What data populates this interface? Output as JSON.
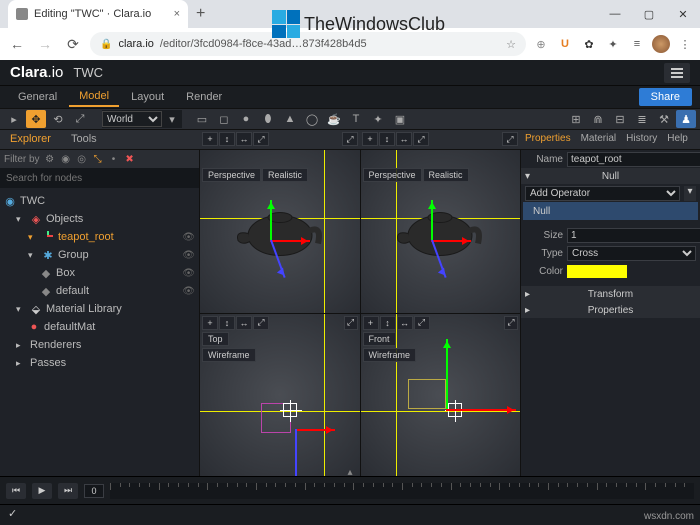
{
  "browser": {
    "tab_title": "Editing \"TWC\" · Clara.io",
    "url_host": "clara.io",
    "url_path": "/editor/3fcd0984-f8ce-43ad…873f428b4d5",
    "ext_u": "U",
    "win_min": "—",
    "win_max": "▢",
    "win_close": "✕",
    "star": "☆",
    "key": "⊕"
  },
  "watermark": {
    "text": "TheWindowsClub",
    "sub": "wsxdn.com"
  },
  "header": {
    "logo1": "Clara",
    "logo2": ".io",
    "project": "TWC"
  },
  "tabs": {
    "general": "General",
    "model": "Model",
    "layout": "Layout",
    "render": "Render",
    "share": "Share"
  },
  "toolbar": {
    "coordsys": "World"
  },
  "panelhead": {
    "explorer": "Explorer",
    "tools": "Tools",
    "properties": "Properties",
    "material": "Material",
    "history": "History",
    "help": "Help"
  },
  "filter": {
    "label": "Filter by",
    "search_ph": "Search for nodes"
  },
  "tree": {
    "root": "TWC",
    "objects": "Objects",
    "teapot": "teapot_root",
    "group": "Group",
    "box": "Box",
    "default": "default",
    "matlib": "Material Library",
    "defaultmat": "defaultMat",
    "renderers": "Renderers",
    "passes": "Passes"
  },
  "viewports": {
    "persp": "Perspective",
    "realistic": "Realistic",
    "top": "Top",
    "front": "Front",
    "wireframe": "Wireframe"
  },
  "props": {
    "name_lbl": "Name",
    "name_val": "teapot_root",
    "null_hdr": "Null",
    "addop": "Add Operator",
    "null_row": "Null",
    "size_lbl": "Size",
    "size_val": "1",
    "type_lbl": "Type",
    "type_val": "Cross",
    "color_lbl": "Color",
    "color_val": "#ffff00",
    "transform": "Transform",
    "properties": "Properties"
  },
  "timeline": {
    "frame": "0"
  }
}
